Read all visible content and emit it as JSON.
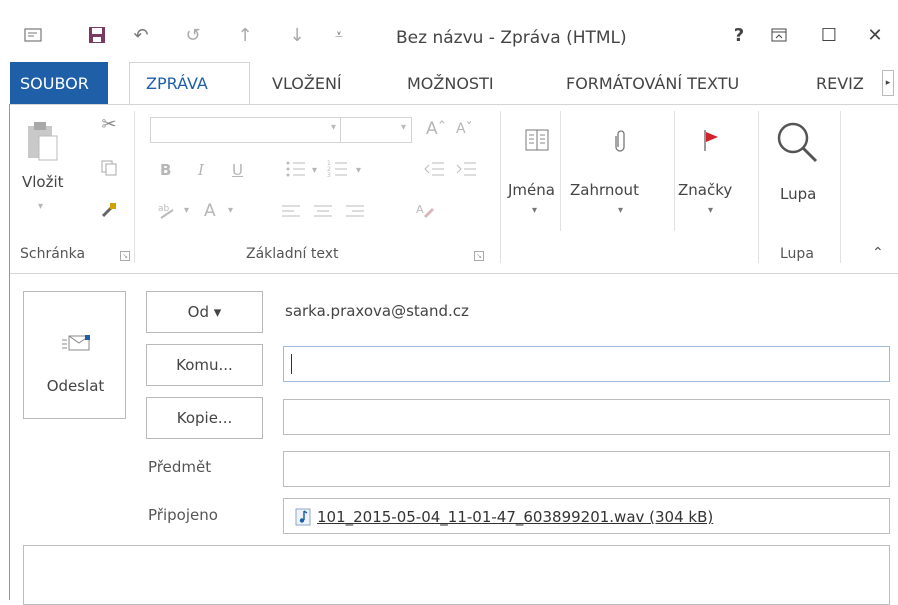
{
  "window": {
    "title": "Bez názvu - Zpráva (HTML)",
    "help": "?",
    "restore_icon": "ribbon-display-icon",
    "maximize": "☐",
    "close": "✕"
  },
  "quick_access": [
    "message-icon",
    "save-icon",
    "undo-icon",
    "redo-icon",
    "up-arrow-icon",
    "down-arrow-icon",
    "customize-icon"
  ],
  "tabs": [
    {
      "label": "SOUBOR"
    },
    {
      "label": "ZPRÁVA"
    },
    {
      "label": "VLOŽENÍ"
    },
    {
      "label": "MOŽNOSTI"
    },
    {
      "label": "FORMÁTOVÁNÍ TEXTU"
    },
    {
      "label": "REVIZ"
    }
  ],
  "ribbon": {
    "clipboard": {
      "paste_label": "Vložit",
      "group_label": "Schránka"
    },
    "basic_text": {
      "bold": "B",
      "italic": "I",
      "underline": "U",
      "font_color": "A",
      "group_label": "Základní text"
    },
    "names": {
      "label": "Jména"
    },
    "include": {
      "label": "Zahrnout"
    },
    "tags": {
      "label": "Značky"
    },
    "zoom": {
      "label": "Lupa",
      "group_label": "Lupa"
    }
  },
  "compose": {
    "send_label": "Odeslat",
    "from_button": "Od ▾",
    "from_value": "sarka.praxova@stand.cz",
    "to_button": "Komu...",
    "to_value": "",
    "cc_button": "Kopie...",
    "cc_value": "",
    "subject_label": "Předmět",
    "subject_value": "",
    "attached_label": "Připojeno",
    "attachment": "101_2015-05-04_11-01-47_603899201.wav (304 kB)"
  },
  "colors": {
    "accent": "#1e5fa8",
    "save_icon": "#7a3b63",
    "flag": "#d2222b"
  }
}
